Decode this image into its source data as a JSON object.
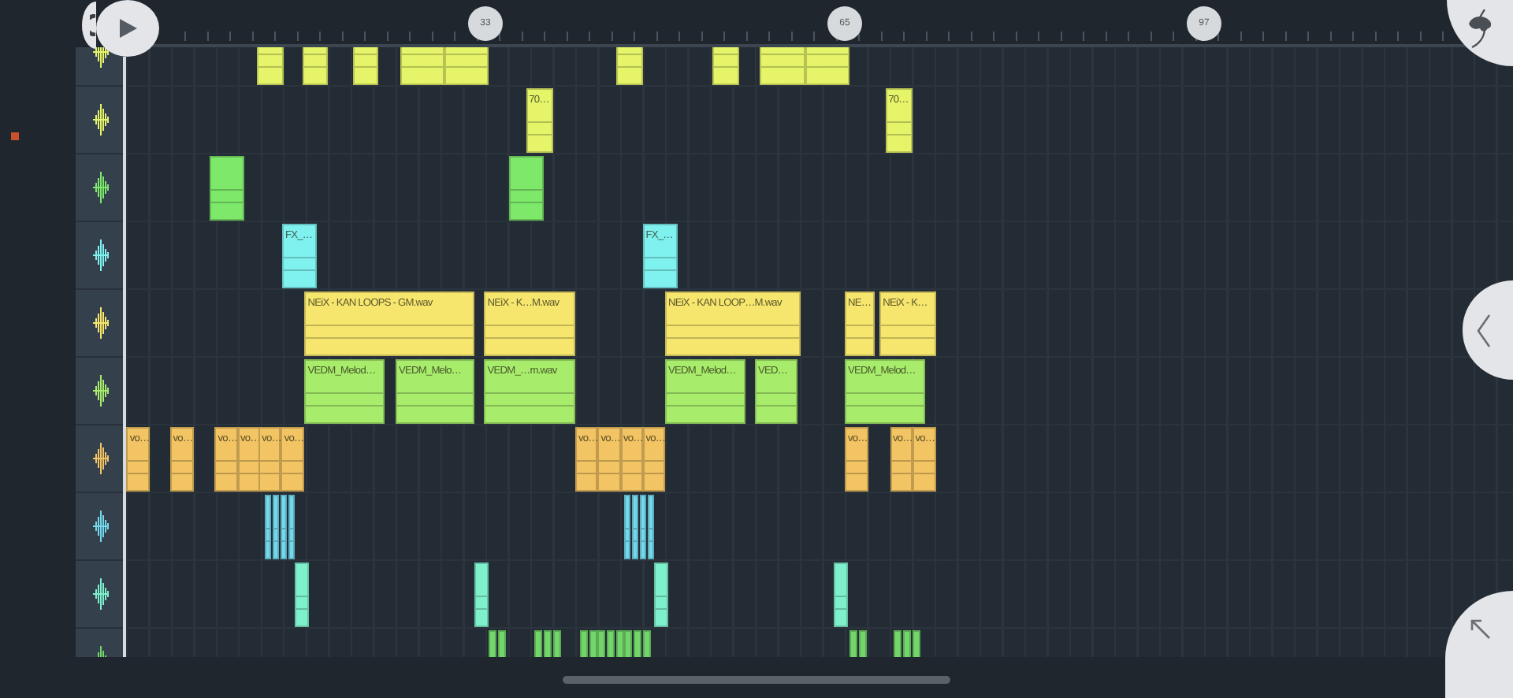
{
  "ruler": {
    "markers": [
      {
        "label": "33"
      },
      {
        "label": "65"
      },
      {
        "label": "97"
      }
    ]
  },
  "tracks": [
    {
      "color": "#e6f46a"
    },
    {
      "color": "#e6f46a",
      "clips": [
        {
          "label": "70…"
        },
        {
          "label": "70…"
        }
      ]
    },
    {
      "color": "#7ee86a"
    },
    {
      "color": "#7ff2f0",
      "clips": [
        {
          "label": "FX_…"
        },
        {
          "label": "FX_…"
        }
      ]
    },
    {
      "color": "#f7e66e",
      "clips": [
        {
          "label": "NEiX - KAN LOOPS - GM.wav"
        },
        {
          "label": "NEiX - K…M.wav"
        },
        {
          "label": "NEiX - KAN LOOP…M.wav"
        },
        {
          "label": "NE…"
        },
        {
          "label": "NEiX - K…"
        }
      ]
    },
    {
      "color": "#a8ec6c",
      "clips": [
        {
          "label": "VEDM_Melod…"
        },
        {
          "label": "VEDM_Melo…"
        },
        {
          "label": "VEDM_…m.wav"
        },
        {
          "label": "VEDM_Melod…"
        },
        {
          "label": "VED…"
        },
        {
          "label": "VEDM_Melod…"
        }
      ]
    },
    {
      "color": "#f2c463",
      "clips": [
        {
          "label": "vo…"
        },
        {
          "label": "vo…"
        },
        {
          "label": "vo…"
        },
        {
          "label": "vo…"
        },
        {
          "label": "vo…"
        },
        {
          "label": "vo…"
        },
        {
          "label": "vo…"
        },
        {
          "label": "vo…"
        },
        {
          "label": "vo…"
        },
        {
          "label": "vo…"
        },
        {
          "label": "vo…"
        },
        {
          "label": "vo…"
        },
        {
          "label": "vo…"
        }
      ]
    },
    {
      "color": "#74d8ec"
    },
    {
      "color": "#7ff0cc"
    },
    {
      "color": "#72d66a"
    }
  ]
}
